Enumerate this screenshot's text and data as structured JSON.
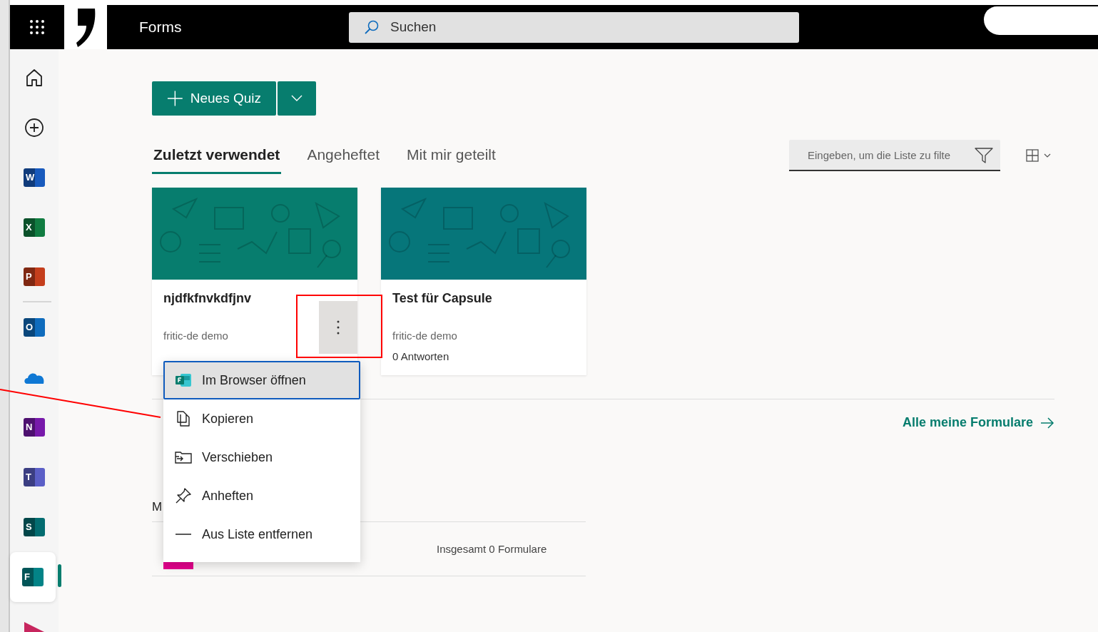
{
  "header": {
    "app_name": "Forms",
    "search_placeholder": "Suchen"
  },
  "rail": [
    {
      "kind": "home",
      "selected": false
    },
    {
      "kind": "create",
      "selected": false
    },
    {
      "kind": "app",
      "letter": "W",
      "color": "#185abd",
      "selected": false
    },
    {
      "kind": "app",
      "letter": "X",
      "color": "#107c41",
      "selected": false
    },
    {
      "kind": "app",
      "letter": "P",
      "color": "#c43e1c",
      "selected": false,
      "divider_after": true
    },
    {
      "kind": "app",
      "letter": "O",
      "color": "#0f6cbd",
      "selected": false
    },
    {
      "kind": "cloud",
      "selected": false
    },
    {
      "kind": "app",
      "letter": "N",
      "color": "#7719aa",
      "selected": false
    },
    {
      "kind": "app",
      "letter": "T",
      "color": "#5b5fc7",
      "selected": false
    },
    {
      "kind": "app",
      "letter": "S",
      "color": "#036c70",
      "selected": false
    },
    {
      "kind": "app",
      "letter": "F",
      "color": "#038387",
      "selected": true
    },
    {
      "kind": "partial",
      "selected": false
    }
  ],
  "new_button": {
    "label": "Neues Quiz"
  },
  "tabs": [
    {
      "label": "Zuletzt verwendet",
      "selected": true
    },
    {
      "label": "Angeheftet",
      "selected": false
    },
    {
      "label": "Mit mir geteilt",
      "selected": false
    }
  ],
  "filter": {
    "placeholder": "Eingeben, um die Liste zu filte"
  },
  "cards": [
    {
      "title": "njdfkfnvkdfjnv",
      "owner": "fritic-de demo",
      "color": "#077d6e",
      "hovered": true
    },
    {
      "title": "Test für Capsule",
      "owner": "fritic-de demo",
      "responses": "0 Antworten",
      "color": "#06767a",
      "hovered": false
    }
  ],
  "all_forms_link": "Alle meine Formulare",
  "group_section": {
    "heading": "M",
    "rows": [
      {
        "color": "#e3008c",
        "count": "Insgesamt 0 Formulare"
      }
    ]
  },
  "context_menu": [
    {
      "kind": "open",
      "label": "Im Browser öffnen",
      "selected": true
    },
    {
      "kind": "copy",
      "label": "Kopieren",
      "selected": false
    },
    {
      "kind": "move",
      "label": "Verschieben",
      "selected": false
    },
    {
      "kind": "pin",
      "label": "Anheften",
      "selected": false
    },
    {
      "kind": "remove",
      "label": "Aus Liste entfernen",
      "selected": false
    }
  ]
}
